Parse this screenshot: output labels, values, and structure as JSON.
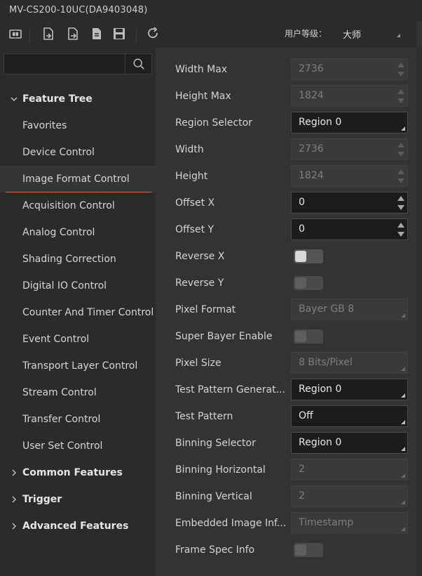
{
  "window": {
    "title": "MV-CS200-10UC(DA9403048)"
  },
  "toolbar": {
    "buttons": [
      {
        "icon": "chip-icon"
      },
      {
        "icon": "import-icon"
      },
      {
        "icon": "export-icon"
      },
      {
        "icon": "document-icon"
      },
      {
        "icon": "save-icon"
      },
      {
        "icon": "refresh-icon"
      }
    ],
    "level_label": "用户等级：",
    "level_value": "大师"
  },
  "sidebar": {
    "search": {
      "placeholder": "",
      "value": ""
    },
    "items": [
      {
        "label": "Feature Tree",
        "group": true,
        "expanded": true
      },
      {
        "label": "Favorites"
      },
      {
        "label": "Device Control"
      },
      {
        "label": "Image Format Control",
        "active": true
      },
      {
        "label": "Acquisition Control"
      },
      {
        "label": "Analog Control"
      },
      {
        "label": "Shading Correction"
      },
      {
        "label": "Digital IO Control"
      },
      {
        "label": "Counter And Timer Control"
      },
      {
        "label": "Event Control"
      },
      {
        "label": "Transport Layer Control"
      },
      {
        "label": "Stream Control"
      },
      {
        "label": "Transfer Control"
      },
      {
        "label": "User Set Control"
      },
      {
        "label": "Common Features",
        "group": true,
        "expanded": false
      },
      {
        "label": "Trigger",
        "group": true,
        "expanded": false
      },
      {
        "label": "Advanced Features",
        "group": true,
        "expanded": false
      }
    ]
  },
  "properties": [
    {
      "name": "Width Max",
      "kind": "spin",
      "value": "2736",
      "enabled": false
    },
    {
      "name": "Height Max",
      "kind": "spin",
      "value": "1824",
      "enabled": false
    },
    {
      "name": "Region Selector",
      "kind": "dropdown",
      "value": "Region 0",
      "enabled": true
    },
    {
      "name": "Width",
      "kind": "spin",
      "value": "2736",
      "enabled": false
    },
    {
      "name": "Height",
      "kind": "spin",
      "value": "1824",
      "enabled": false
    },
    {
      "name": "Offset X",
      "kind": "spin",
      "value": "0",
      "enabled": true
    },
    {
      "name": "Offset Y",
      "kind": "spin",
      "value": "0",
      "enabled": true
    },
    {
      "name": "Reverse X",
      "kind": "toggle",
      "enabled": true,
      "on": false
    },
    {
      "name": "Reverse Y",
      "kind": "toggle",
      "enabled": false,
      "on": false
    },
    {
      "name": "Pixel Format",
      "kind": "dropdown",
      "value": "Bayer GB 8",
      "enabled": false
    },
    {
      "name": "Super Bayer Enable",
      "kind": "toggle",
      "enabled": false,
      "on": false
    },
    {
      "name": "Pixel Size",
      "kind": "dropdown",
      "value": "8 Bits/Pixel",
      "enabled": false
    },
    {
      "name": "Test Pattern Generat...",
      "kind": "dropdown",
      "value": "Region 0",
      "enabled": true
    },
    {
      "name": "Test Pattern",
      "kind": "dropdown",
      "value": "Off",
      "enabled": true
    },
    {
      "name": "Binning Selector",
      "kind": "dropdown",
      "value": "Region 0",
      "enabled": true
    },
    {
      "name": "Binning Horizontal",
      "kind": "dropdown",
      "value": "2",
      "enabled": false
    },
    {
      "name": "Binning Vertical",
      "kind": "dropdown",
      "value": "2",
      "enabled": false
    },
    {
      "name": "Embedded Image Inf...",
      "kind": "dropdown",
      "value": "Timestamp",
      "enabled": false
    },
    {
      "name": "Frame Spec Info",
      "kind": "toggle",
      "enabled": false,
      "on": false
    }
  ],
  "colors": {
    "accent": "#e06a2a",
    "background": "#2b2b2b",
    "panel": "#333333"
  }
}
